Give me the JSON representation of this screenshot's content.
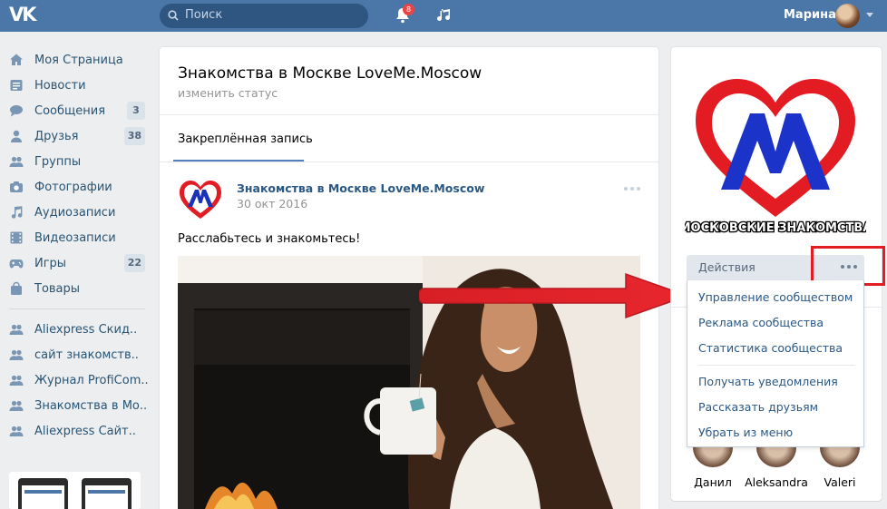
{
  "header": {
    "logo_text": "VK",
    "search_placeholder": "Поиск",
    "notifications_count": "8",
    "user_name": "Марина"
  },
  "sidebar": {
    "items": [
      {
        "label": "Моя Страница",
        "icon": "home-icon"
      },
      {
        "label": "Новости",
        "icon": "news-icon"
      },
      {
        "label": "Сообщения",
        "icon": "messages-icon",
        "count": "3"
      },
      {
        "label": "Друзья",
        "icon": "friends-icon",
        "count": "38"
      },
      {
        "label": "Группы",
        "icon": "groups-icon"
      },
      {
        "label": "Фотографии",
        "icon": "camera-icon"
      },
      {
        "label": "Аудиозаписи",
        "icon": "music-note-icon"
      },
      {
        "label": "Видеозаписи",
        "icon": "film-icon"
      },
      {
        "label": "Игры",
        "icon": "gamepad-icon",
        "count": "22"
      },
      {
        "label": "Товары",
        "icon": "bag-icon"
      }
    ],
    "groups": [
      {
        "label": "Aliexpress Скид.."
      },
      {
        "label": "сайт знакомств.."
      },
      {
        "label": "Журнал ProfiCom.."
      },
      {
        "label": "Знакомства в Мо.."
      },
      {
        "label": "Aliexpress Сайт.."
      }
    ]
  },
  "main": {
    "title": "Знакомства в Москве LoveMe.Moscow",
    "status_link": "изменить статус",
    "tab": "Закреплённая запись",
    "post": {
      "author": "Знакомства в Москве LoveMe.Moscow",
      "date": "30 окт 2016",
      "text": "Расслабьтесь и знакомьтесь!"
    }
  },
  "right": {
    "logo_caption": "МОСКОВСКИЕ ЗНАКОМСТВА",
    "actions_label": "Действия",
    "menu": [
      {
        "label": "Управление сообществом"
      },
      {
        "label": "Реклама сообщества"
      },
      {
        "label": "Статистика сообщества"
      },
      {
        "label": "Получать уведомления"
      },
      {
        "label": "Рассказать друзьям"
      },
      {
        "label": "Убрать из меню"
      }
    ],
    "members": [
      {
        "name": "Данил"
      },
      {
        "name": "Aleksandra"
      },
      {
        "name": "Valeri"
      }
    ]
  },
  "colors": {
    "header_bg": "#4a76a8",
    "link": "#2a5885",
    "annotation_red": "#e31b23"
  }
}
